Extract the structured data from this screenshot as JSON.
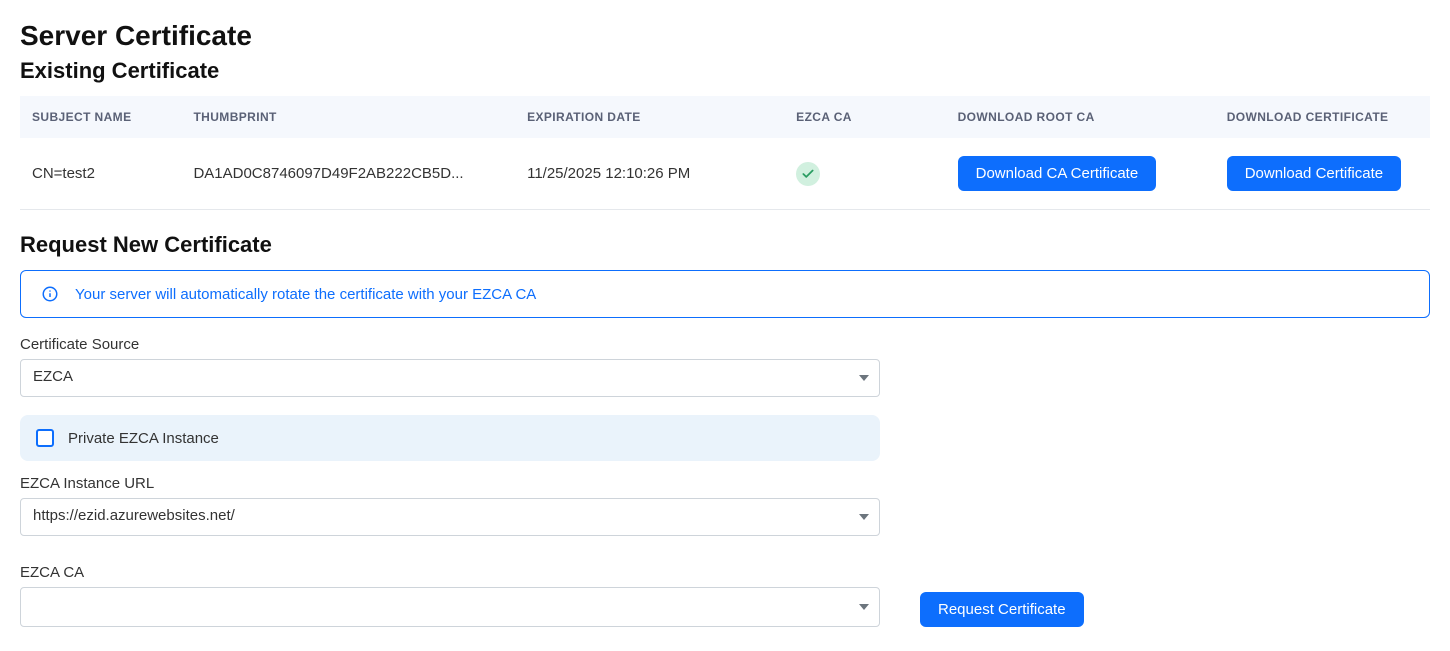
{
  "page": {
    "title": "Server Certificate",
    "existing_heading": "Existing Certificate",
    "request_heading": "Request New Certificate"
  },
  "table": {
    "headers": {
      "subject": "SUBJECT NAME",
      "thumbprint": "THUMBPRINT",
      "expiration": "EXPIRATION DATE",
      "ezca_ca": "EZCA CA",
      "download_root": "DOWNLOAD ROOT CA",
      "download_cert": "DOWNLOAD CERTIFICATE"
    },
    "rows": [
      {
        "subject": "CN=test2",
        "thumbprint": "DA1AD0C8746097D49F2AB222CB5D...",
        "expiration": "11/25/2025 12:10:26 PM",
        "ezca_ca_ok": true,
        "download_root_label": "Download CA Certificate",
        "download_cert_label": "Download Certificate"
      }
    ]
  },
  "banner": {
    "message": "Your server will automatically rotate the certificate with your EZCA CA"
  },
  "form": {
    "cert_source_label": "Certificate Source",
    "cert_source_value": "EZCA",
    "private_instance_label": "Private EZCA Instance",
    "private_instance_checked": false,
    "instance_url_label": "EZCA Instance URL",
    "instance_url_value": "https://ezid.azurewebsites.net/",
    "ezca_ca_label": "EZCA CA",
    "ezca_ca_value": "",
    "submit_label": "Request Certificate"
  }
}
